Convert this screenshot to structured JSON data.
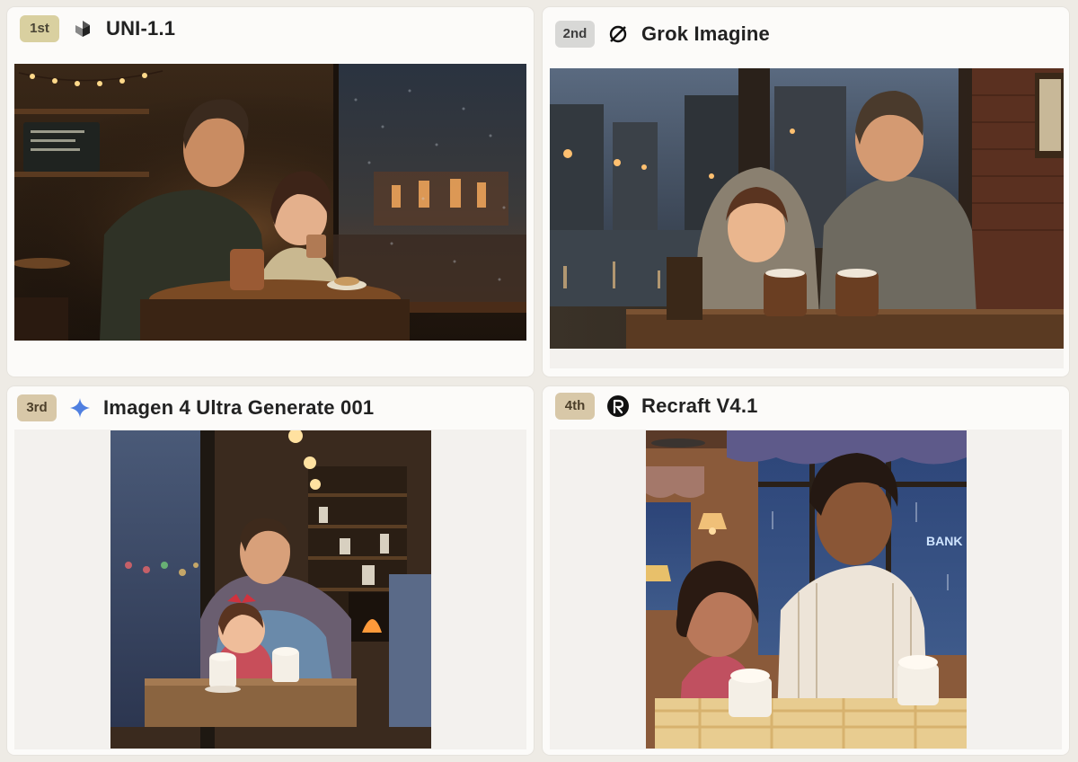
{
  "cards": [
    {
      "rank": "1st",
      "model": "UNI-1.1",
      "logo_icon": "uni-cube-icon",
      "image_desc": "illustration-father-daughter-cafe-rain"
    },
    {
      "rank": "2nd",
      "model": "Grok Imagine",
      "logo_icon": "grok-slash-circle-icon",
      "image_desc": "illustration-father-daughter-cafe-rain"
    },
    {
      "rank": "3rd",
      "model": "Imagen 4 Ultra Generate 001",
      "logo_icon": "gemini-sparkle-icon",
      "image_desc": "illustration-father-daughter-cafe-rain"
    },
    {
      "rank": "4th",
      "model": "Recraft V4.1",
      "logo_icon": "recraft-r-icon",
      "image_desc": "illustration-father-daughter-cafe-rain"
    }
  ],
  "image_signs": {
    "bank": "BANK"
  },
  "colors": {
    "gold_badge": "#d9d0a0",
    "silver_badge": "#d8d8d6",
    "bronze_badge": "#d8c8a8",
    "gemini_blue": "#4f7fe0"
  }
}
